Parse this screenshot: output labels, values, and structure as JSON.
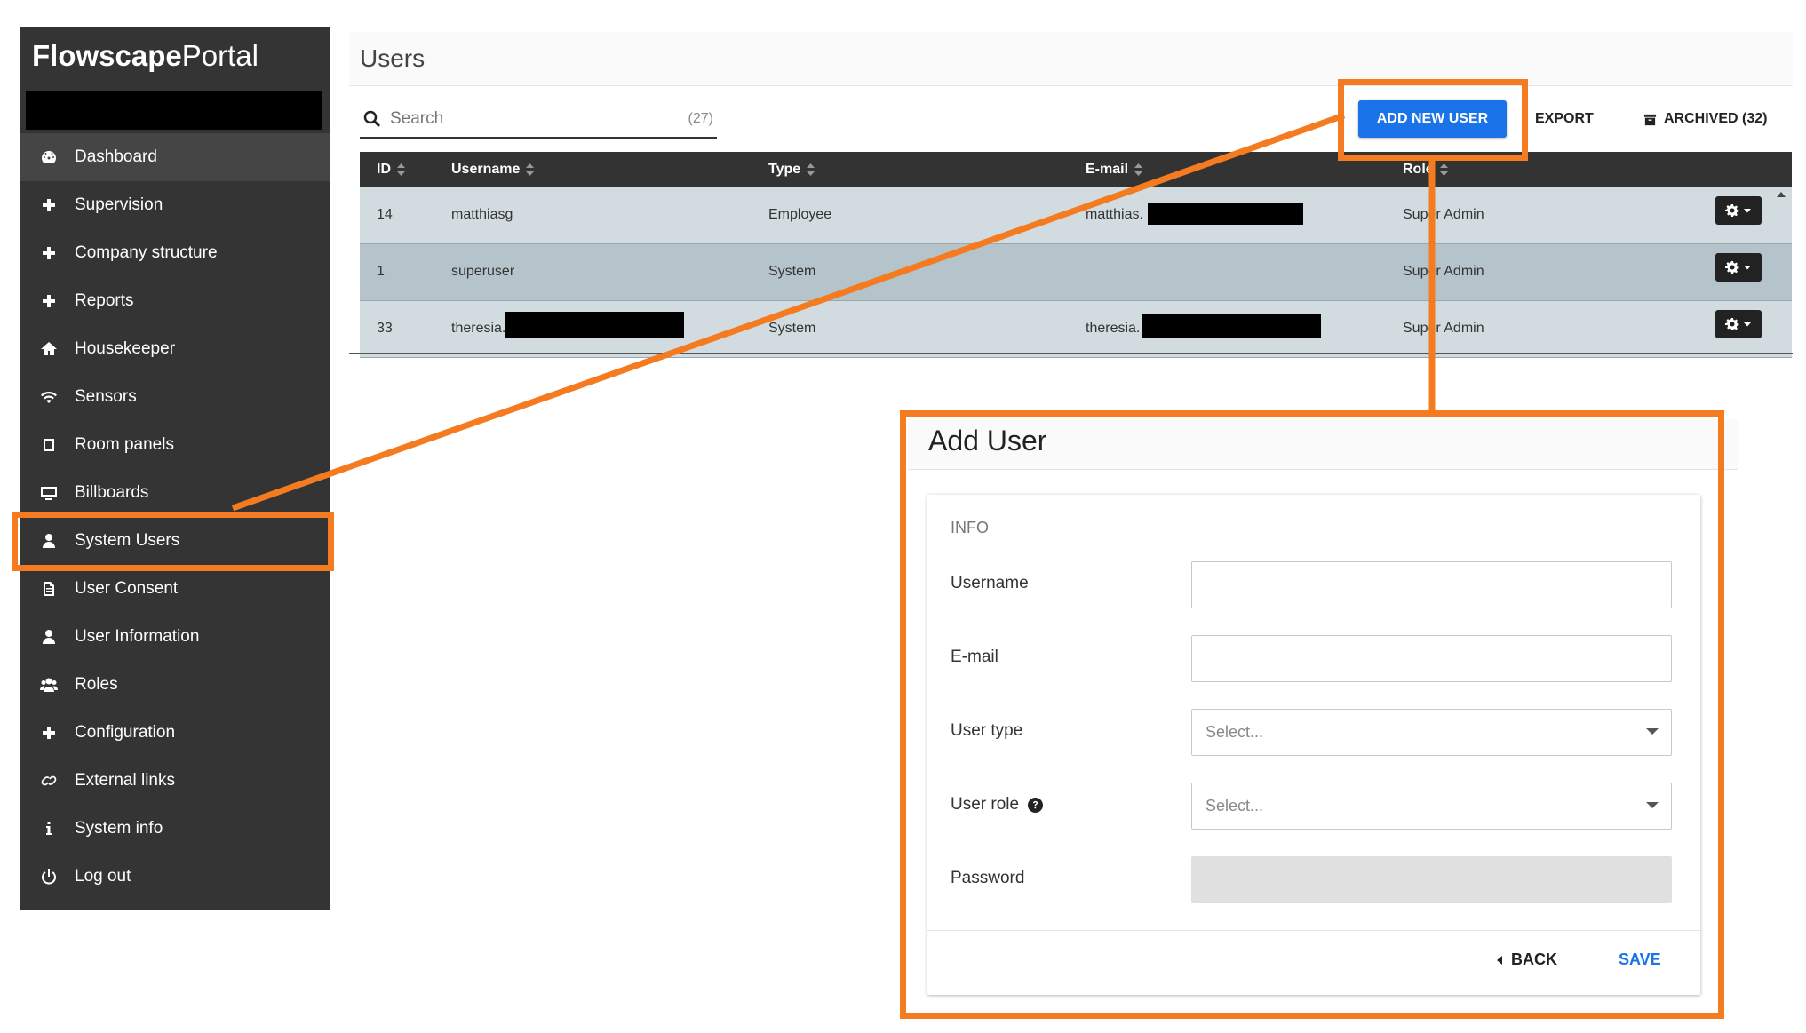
{
  "app": {
    "brand_bold": "Flowscape",
    "brand_light": "Portal"
  },
  "sidebar": {
    "items": [
      {
        "label": "Dashboard",
        "icon": "dashboard-icon",
        "active": true
      },
      {
        "label": "Supervision",
        "icon": "plus-icon"
      },
      {
        "label": "Company structure",
        "icon": "plus-icon"
      },
      {
        "label": "Reports",
        "icon": "plus-icon"
      },
      {
        "label": "Housekeeper",
        "icon": "home-icon"
      },
      {
        "label": "Sensors",
        "icon": "wifi-icon"
      },
      {
        "label": "Room panels",
        "icon": "square-icon"
      },
      {
        "label": "Billboards",
        "icon": "monitor-icon"
      },
      {
        "label": "System Users",
        "icon": "user-icon"
      },
      {
        "label": "User Consent",
        "icon": "document-icon"
      },
      {
        "label": "User Information",
        "icon": "user-icon"
      },
      {
        "label": "Roles",
        "icon": "users-icon"
      },
      {
        "label": "Configuration",
        "icon": "plus-icon"
      },
      {
        "label": "External links",
        "icon": "link-icon"
      },
      {
        "label": "System info",
        "icon": "info-icon"
      },
      {
        "label": "Log out",
        "icon": "power-icon"
      }
    ]
  },
  "users_page": {
    "title": "Users",
    "search": {
      "placeholder": "Search",
      "count": "(27)"
    },
    "toolbar": {
      "add_label": "ADD NEW USER",
      "export_label": "EXPORT",
      "archived_label": "ARCHIVED (32)"
    },
    "columns": [
      "ID",
      "Username",
      "Type",
      "E-mail",
      "Role"
    ],
    "rows": [
      {
        "id": "14",
        "username": "matthiasg",
        "type": "Employee",
        "email": "matthias.",
        "role": "Super Admin"
      },
      {
        "id": "1",
        "username": "superuser",
        "type": "System",
        "email": "",
        "role": "Super Admin"
      },
      {
        "id": "33",
        "username": "theresia.",
        "type": "System",
        "email": "theresia.",
        "role": "Super Admin"
      }
    ]
  },
  "add_user": {
    "title": "Add User",
    "section": "INFO",
    "labels": {
      "username": "Username",
      "email": "E-mail",
      "user_type": "User type",
      "user_role": "User role",
      "password": "Password"
    },
    "select_placeholder": "Select...",
    "back_label": "BACK",
    "save_label": "SAVE"
  },
  "colors": {
    "sidebar_bg": "#343434",
    "accent": "#1a73e8",
    "highlight": "#f47b20",
    "row_a": "#d2dbe0",
    "row_b": "#b5c3cb"
  }
}
